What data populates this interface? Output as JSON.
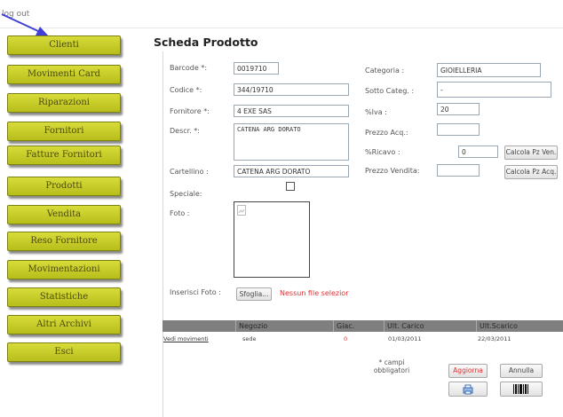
{
  "header": {
    "logout_label": "log out"
  },
  "sidebar": {
    "items": [
      {
        "label": "Clienti"
      },
      {
        "label": "Movimenti Card"
      },
      {
        "label": "Riparazioni"
      },
      {
        "label": "Fornitori"
      },
      {
        "label": "Fatture Fornitori"
      },
      {
        "label": "Prodotti"
      },
      {
        "label": "Vendita"
      },
      {
        "label": "Reso Fornitore"
      },
      {
        "label": "Movimentazioni"
      },
      {
        "label": "Statistiche"
      },
      {
        "label": "Altri Archivi"
      },
      {
        "label": "Esci"
      }
    ]
  },
  "page": {
    "title": "Scheda Prodotto"
  },
  "form": {
    "barcode_label": "Barcode *:",
    "barcode_value": "0019710",
    "codice_label": "Codice *:",
    "codice_value": "344/19710",
    "fornitore_label": "Fornitore *:",
    "fornitore_value": "4 EXE SAS",
    "descr_label": "Descr. *:",
    "descr_value": "CATENA ARG DORATO",
    "cartellino_label": "Cartellino :",
    "cartellino_value": "CATENA ARG DORATO",
    "speciale_label": "Speciale:",
    "foto_label": "Foto :",
    "inserisci_label": "Inserisci Foto :",
    "sfoglia_label": "Sfoglia...",
    "nessun_file": "Nessun file selezior",
    "categoria_label": "Categoria :",
    "categoria_value": "GIOIELLERIA",
    "sottocateg_label": "Sotto Categ. :",
    "sottocateg_value": "-",
    "iva_label": "%Iva :",
    "iva_value": "20",
    "prezzo_acq_label": "Prezzo Acq.:",
    "prezzo_acq_value": "",
    "ricavo_label": "%Ricavo :",
    "ricavo_value": "0",
    "calcola_ven_label": "Calcola Pz Ven.",
    "prezzo_vendita_label": "Prezzo Vendita:",
    "prezzo_vendita_value": "",
    "calcola_acq_label": "Calcola Pz Acq."
  },
  "table": {
    "headers": [
      "Negozio",
      "Giac.",
      "Ult. Carico",
      "Ult.Scarico"
    ],
    "rows": [
      {
        "link": "Vedi movimenti",
        "negozio": "sede",
        "giac": "0",
        "ult_carico": "01/03/2011",
        "ult_scarico": "22/03/2011"
      }
    ]
  },
  "footer": {
    "note_line1": "* campi",
    "note_line2": "obbligatori",
    "aggiorna_label": "Aggiorna",
    "annulla_label": "Annulla"
  },
  "colors": {
    "menu": "#c9ce2a",
    "accent_red": "#e03030",
    "arrow": "#4040d8"
  }
}
